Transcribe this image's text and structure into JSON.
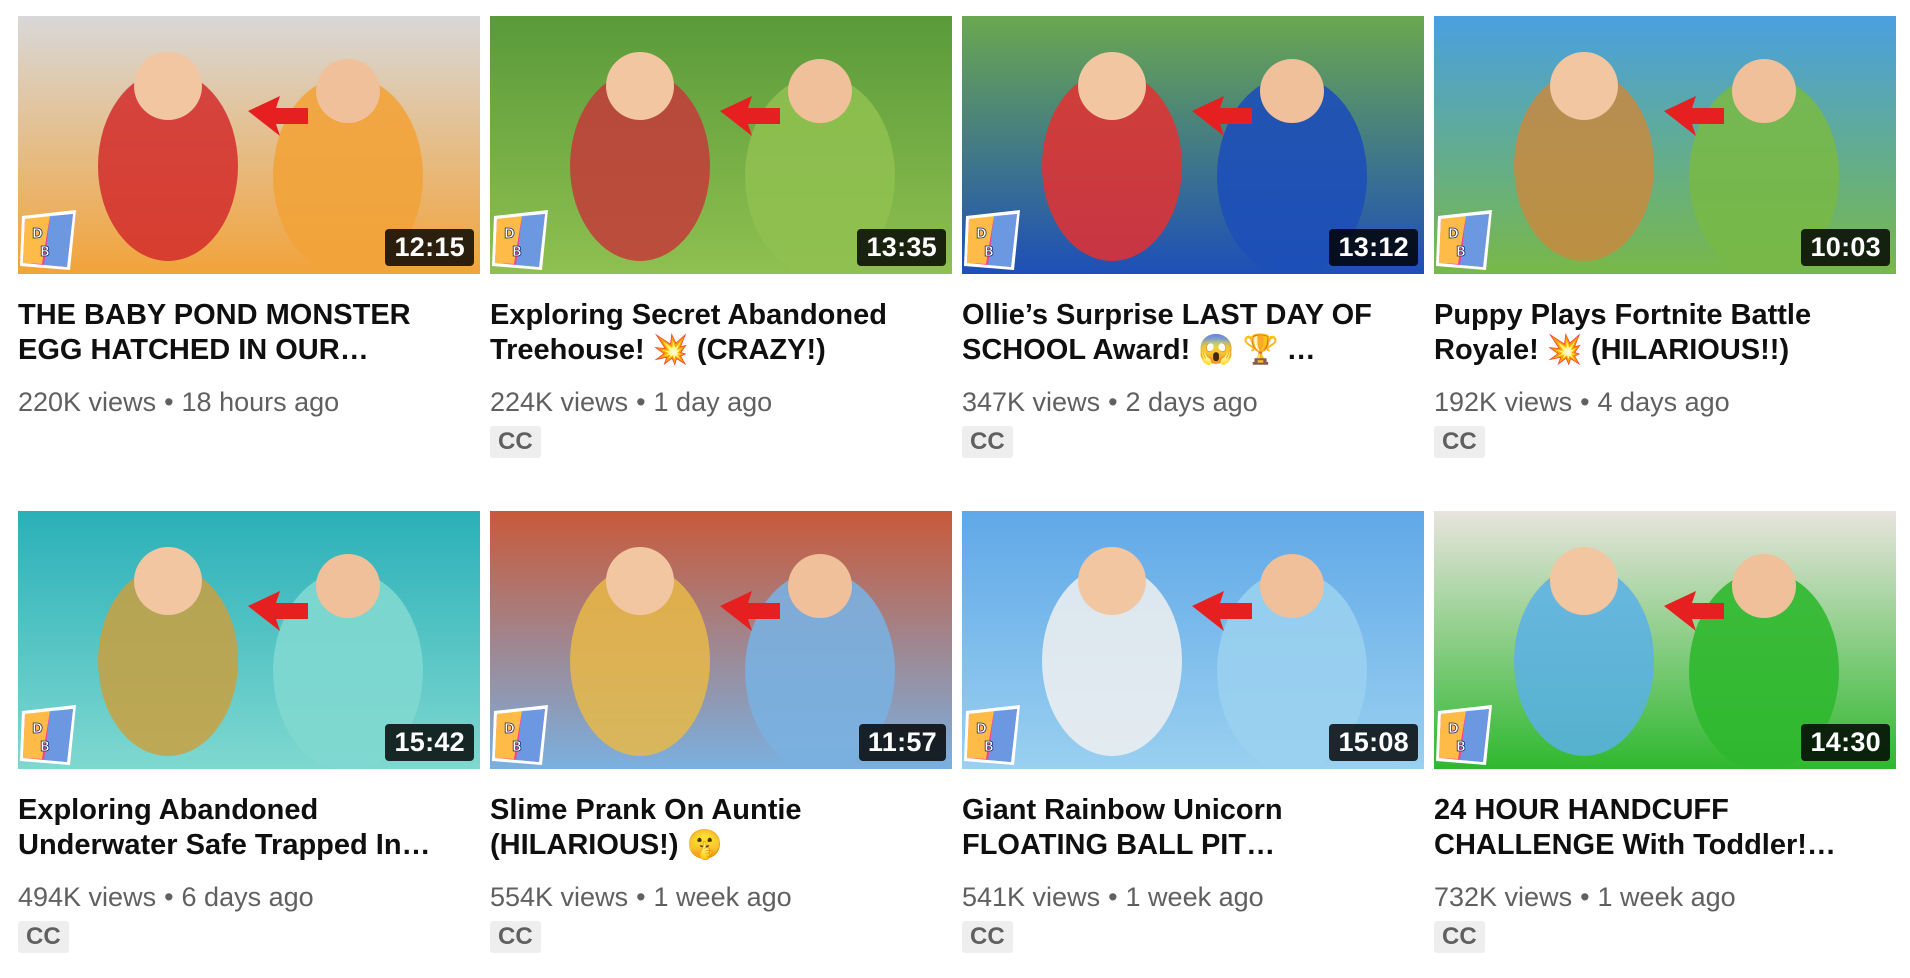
{
  "videos": [
    {
      "title": "THE BABY POND MONSTER EGG HATCHED IN OUR…",
      "views": "220K views",
      "age": "18 hours ago",
      "duration": "12:15",
      "cc": "",
      "scene": "kitchen",
      "colors": [
        "#d8d8d8",
        "#f2a33a",
        "#d22b2b"
      ]
    },
    {
      "title": "Exploring Secret Abandoned Treehouse! 💥  (CRAZY!)",
      "views": "224K views",
      "age": "1 day ago",
      "duration": "13:35",
      "cc": "CC",
      "scene": "treehouse",
      "colors": [
        "#5a9a3a",
        "#8fc050",
        "#c43a3a"
      ]
    },
    {
      "title": "Ollie’s Surprise LAST DAY OF SCHOOL Award! 😱 🏆 …",
      "views": "347K views",
      "age": "2 days ago",
      "duration": "13:12",
      "cc": "CC",
      "scene": "award",
      "colors": [
        "#6aa84f",
        "#1d4fb8",
        "#e53030"
      ]
    },
    {
      "title": "Puppy Plays Fortnite Battle Royale! 💥  (HILARIOUS!!)",
      "views": "192K views",
      "age": "4 days ago",
      "duration": "10:03",
      "cc": "CC",
      "scene": "fortnite",
      "colors": [
        "#4aa0e0",
        "#78b848",
        "#c88a40"
      ]
    },
    {
      "title": "Exploring Abandoned Underwater Safe Trapped In…",
      "views": "494K views",
      "age": "6 days ago",
      "duration": "15:42",
      "cc": "CC",
      "scene": "underwater",
      "colors": [
        "#2ab0b8",
        "#7fd8d0",
        "#c9a040"
      ]
    },
    {
      "title": "Slime Prank On Auntie (HILARIOUS!) 🤫",
      "views": "554K views",
      "age": "1 week ago",
      "duration": "11:57",
      "cc": "CC",
      "scene": "slime",
      "colors": [
        "#c85a3a",
        "#7ab0e0",
        "#e8b848"
      ]
    },
    {
      "title": "Giant Rainbow Unicorn FLOATING BALL PIT…",
      "views": "541K views",
      "age": "1 week ago",
      "duration": "15:08",
      "cc": "CC",
      "scene": "unicorn",
      "colors": [
        "#60a8e8",
        "#9ad0f0",
        "#f0f0f0"
      ]
    },
    {
      "title": "24 HOUR HANDCUFF CHALLENGE With Toddler!…",
      "views": "732K views",
      "age": "1 week ago",
      "duration": "14:30",
      "cc": "CC",
      "scene": "handcuff",
      "colors": [
        "#e8e4de",
        "#2fb82f",
        "#5ab0e8"
      ]
    }
  ],
  "channel_logo": {
    "icon": "dally-bun-logo",
    "colors": [
      "#ff3b8a",
      "#ffd23b",
      "#3bb8ff"
    ]
  }
}
